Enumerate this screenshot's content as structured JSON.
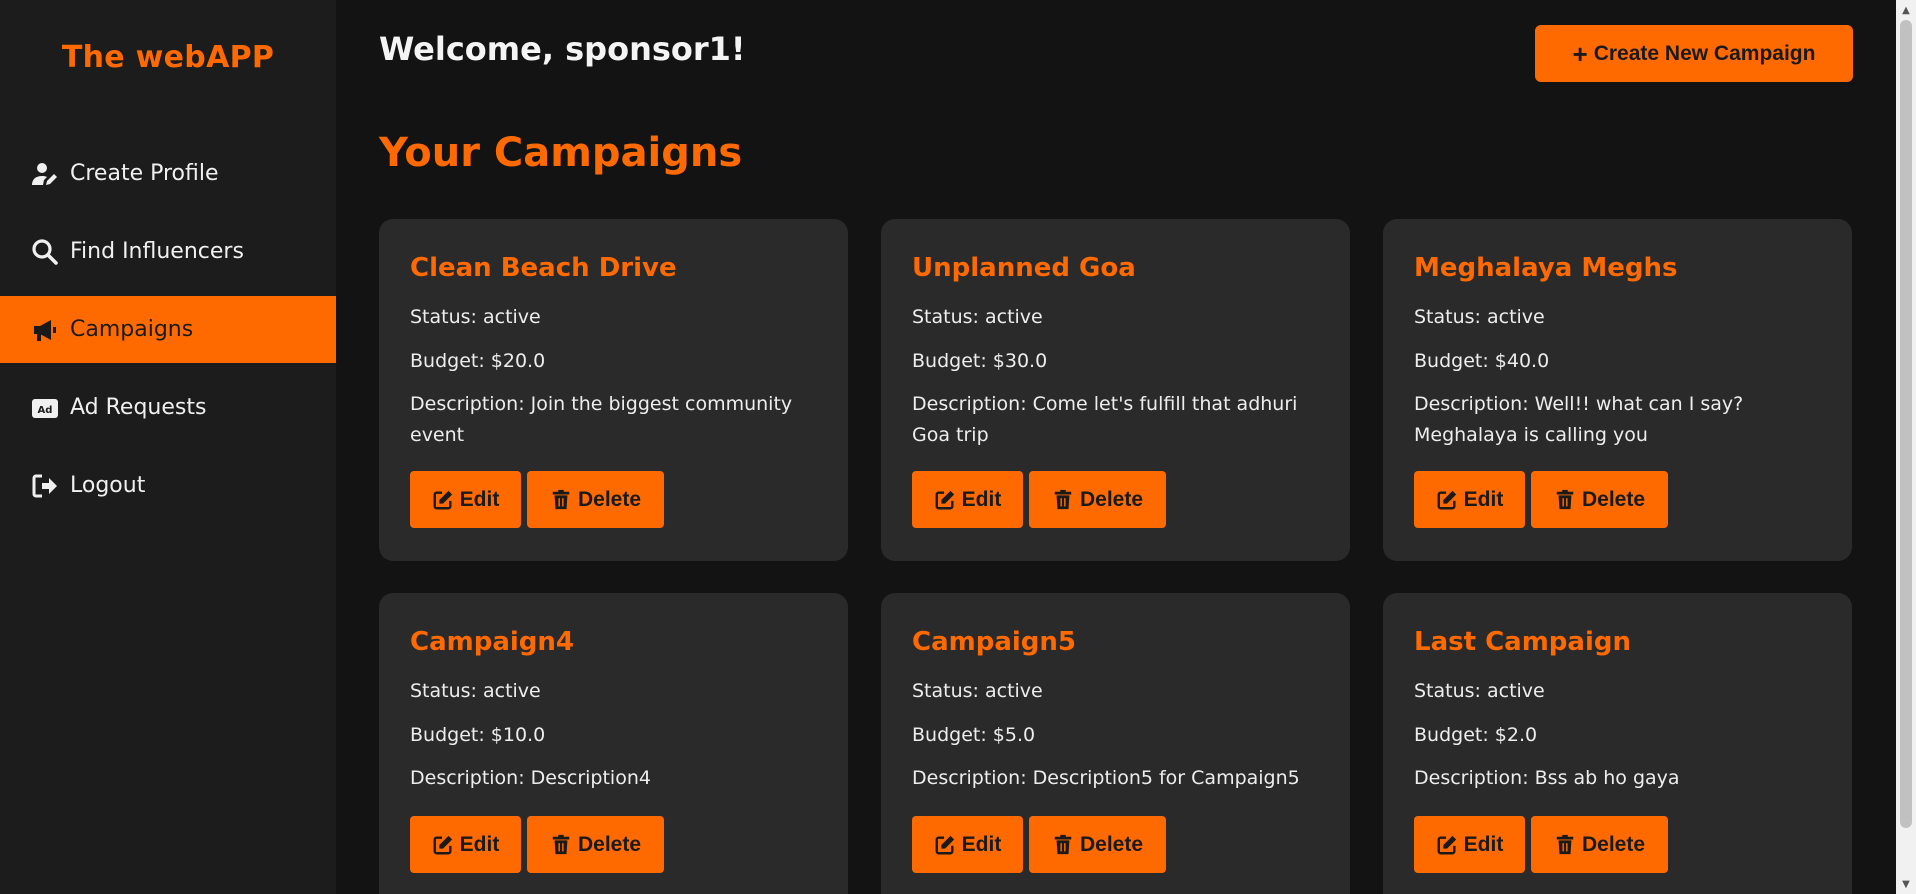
{
  "brand": {
    "title": "The webAPP"
  },
  "sidebar": {
    "items": [
      {
        "label": "Create Profile",
        "icon": "user-edit-icon",
        "active": false
      },
      {
        "label": "Find Influencers",
        "icon": "search-icon",
        "active": false
      },
      {
        "label": "Campaigns",
        "icon": "megaphone-icon",
        "active": true
      },
      {
        "label": "Ad Requests",
        "icon": "ad-icon",
        "active": false
      },
      {
        "label": "Logout",
        "icon": "logout-icon",
        "active": false
      }
    ]
  },
  "header": {
    "welcome": "Welcome, sponsor1!",
    "create_button": "Create New Campaign",
    "create_icon": "plus-icon"
  },
  "main": {
    "section_title": "Your Campaigns",
    "campaigns": [
      {
        "name": "Clean Beach Drive",
        "status": "Status: active",
        "budget": "Budget: $20.0",
        "description": "Description: Join the biggest community event"
      },
      {
        "name": "Unplanned Goa",
        "status": "Status: active",
        "budget": "Budget: $30.0",
        "description": "Description: Come let's fulfill that adhuri Goa trip"
      },
      {
        "name": "Meghalaya Meghs",
        "status": "Status: active",
        "budget": "Budget: $40.0",
        "description": "Description: Well!! what can I say? Meghalaya is calling you"
      },
      {
        "name": "Campaign4",
        "status": "Status: active",
        "budget": "Budget: $10.0",
        "description": "Description: Description4"
      },
      {
        "name": "Campaign5",
        "status": "Status: active",
        "budget": "Budget: $5.0",
        "description": "Description: Description5 for Campaign5"
      },
      {
        "name": "Last Campaign",
        "status": "Status: active",
        "budget": "Budget: $2.0",
        "description": "Description: Bss ab ho gaya"
      }
    ],
    "edit_label": "Edit",
    "delete_label": "Delete"
  },
  "colors": {
    "accent": "#ff6a00",
    "background": "#131313",
    "sidebar": "#1c1c1c",
    "card": "#2a2a2a"
  }
}
